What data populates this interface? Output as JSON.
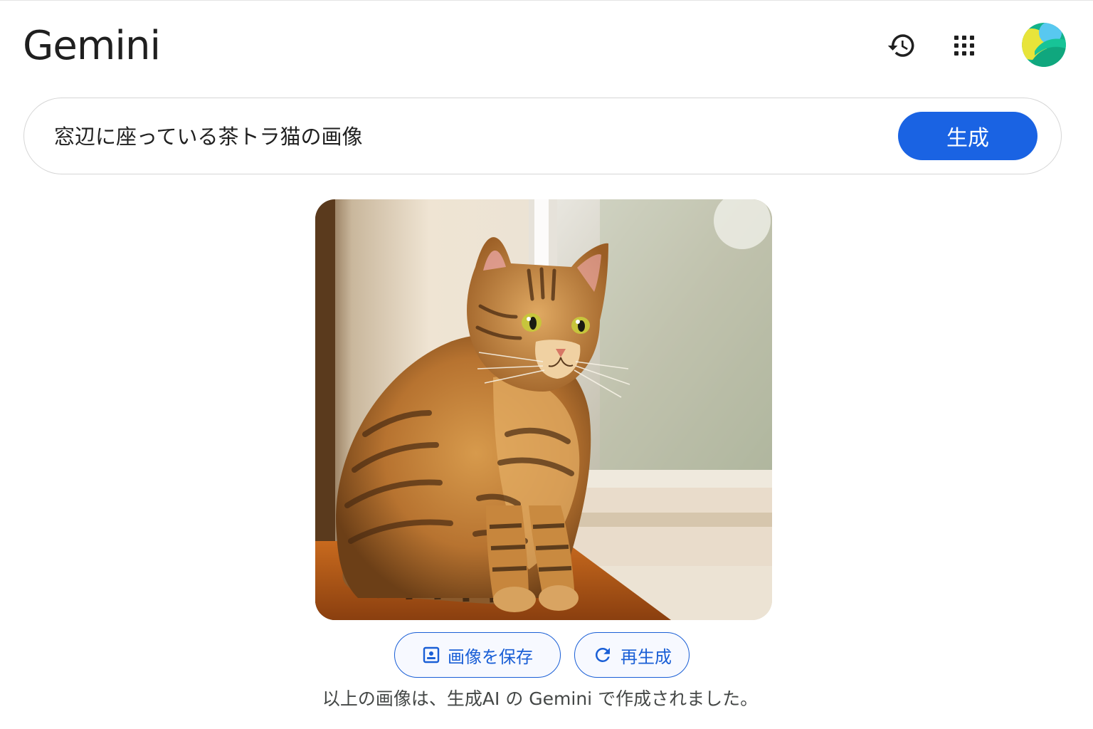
{
  "header": {
    "app_title": "Gemini",
    "history_icon": "history-icon",
    "apps_icon": "apps-grid-icon",
    "avatar_icon": "account-avatar"
  },
  "prompt": {
    "value": "窓辺に座っている茶トラ猫の画像",
    "placeholder": "",
    "generate_label": "生成"
  },
  "result": {
    "image_description_alt": "窓辺に座っている茶トラ猫の画像",
    "save_label": "画像を保存",
    "save_icon": "save-image-icon",
    "regenerate_label": "再生成",
    "regenerate_icon": "refresh-icon",
    "caption": "以上の画像は、生成AI の Gemini で作成されました。"
  },
  "colors": {
    "accent": "#1a63e3",
    "text": "#1f1f1f",
    "caption": "#444746"
  }
}
